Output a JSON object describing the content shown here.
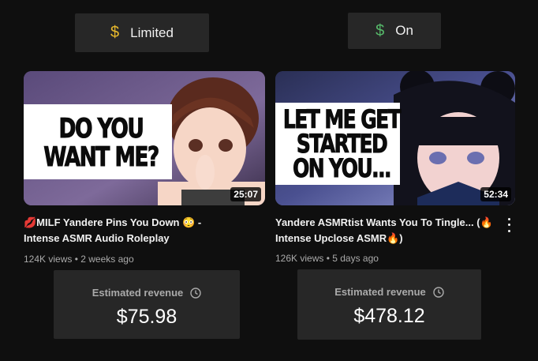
{
  "monetization": {
    "left": {
      "symbol": "$",
      "label": "Limited",
      "color": "#e8b92c"
    },
    "right": {
      "symbol": "$",
      "label": "On",
      "color": "#56b96a"
    }
  },
  "videos": [
    {
      "thumbnail_text": [
        "DO YOU",
        "WANT ME?"
      ],
      "duration": "25:07",
      "title_line1": "💋MILF Yandere Pins You Down 😳 -",
      "title_line2": "Intense ASMR Audio Roleplay",
      "meta": "124K views • 2 weeks ago",
      "revenue_label": "Estimated revenue",
      "revenue_value": "$75.98"
    },
    {
      "thumbnail_text": [
        "LET ME GET",
        "STARTED",
        "ON YOU..."
      ],
      "duration": "52:34",
      "title_line1": "Yandere ASMRtist Wants You To Tingle... (🔥",
      "title_line2": "Intense Upclose ASMR🔥)",
      "meta": "126K views • 5 days ago",
      "revenue_label": "Estimated revenue",
      "revenue_value": "$478.12"
    }
  ],
  "icons": [
    "dollar-icon",
    "clock-icon",
    "more-vert-icon"
  ]
}
